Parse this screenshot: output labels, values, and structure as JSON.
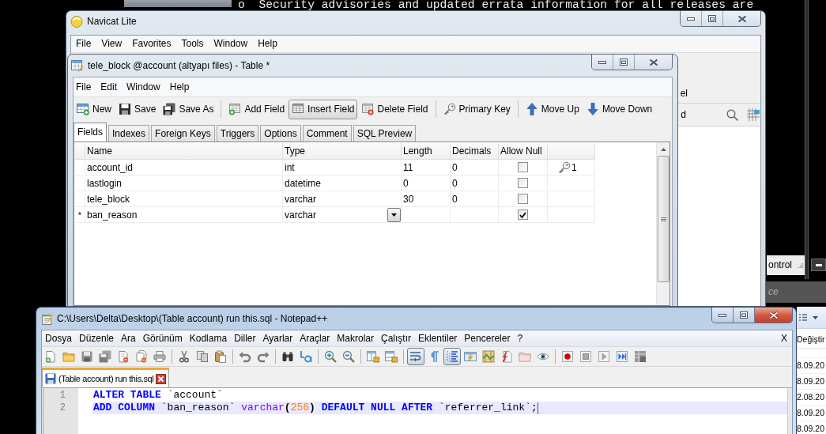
{
  "background_terminal": {
    "lines": [
      "o  Security advisories and updated errata information for all releases are"
    ]
  },
  "navicat_window": {
    "title": "Navicat Lite",
    "active": false,
    "menu": [
      "File",
      "View",
      "Favorites",
      "Tools",
      "Window",
      "Help"
    ],
    "toolbar_fragment": "el",
    "tab_fragment": "d"
  },
  "table_window": {
    "title": "tele_block @account (altyapı files) - Table *",
    "active": false,
    "menu": [
      "File",
      "Edit",
      "Window",
      "Help"
    ],
    "toolbar": [
      [
        {
          "label": "New",
          "pressed": false
        },
        {
          "label": "Save",
          "pressed": false
        },
        {
          "label": "Save As",
          "pressed": false
        }
      ],
      [
        {
          "label": "Add Field",
          "pressed": false
        },
        {
          "label": "Insert Field",
          "pressed": true
        },
        {
          "label": "Delete Field",
          "pressed": false
        }
      ],
      [
        {
          "label": "Primary Key",
          "pressed": false
        }
      ],
      [
        {
          "label": "Move Up",
          "pressed": false
        },
        {
          "label": "Move Down",
          "pressed": false
        }
      ]
    ],
    "tabs": [
      {
        "label": "Fields",
        "selected": true
      },
      {
        "label": "Indexes",
        "selected": false
      },
      {
        "label": "Foreign Keys",
        "selected": false
      },
      {
        "label": "Triggers",
        "selected": false
      },
      {
        "label": "Options",
        "selected": false
      },
      {
        "label": "Comment",
        "selected": false
      },
      {
        "label": "SQL Preview",
        "selected": false
      }
    ],
    "grid": {
      "columns": [
        "Name",
        "Type",
        "Length",
        "Decimals",
        "Allow Null"
      ],
      "rows": [
        {
          "name": "account_id",
          "type": "int",
          "length": "11",
          "decimals": "0",
          "allow_null": false,
          "editing": false,
          "key": "1"
        },
        {
          "name": "lastlogin",
          "type": "datetime",
          "length": "0",
          "decimals": "0",
          "allow_null": false,
          "editing": false
        },
        {
          "name": "tele_block",
          "type": "varchar",
          "length": "30",
          "decimals": "0",
          "allow_null": false,
          "editing": false
        },
        {
          "marker": "*",
          "name": "ban_reason",
          "type": "varchar",
          "allow_null": true,
          "editing": true
        }
      ]
    }
  },
  "console_window": {
    "status_text": "ontrol"
  },
  "search_field": {
    "placeholder": "ce"
  },
  "explorer_window": {
    "column_header": "Değiştir",
    "rows": [
      "8.09.20",
      "8.09.20",
      "2.08.20",
      "8.09.20",
      "8.09.20"
    ]
  },
  "notepad_window": {
    "title": "C:\\Users\\Delta\\Desktop\\(Table account) run this.sql - Notepad++",
    "active": true,
    "menu": [
      "Dosya",
      "Düzenle",
      "Ara",
      "Görünüm",
      "Kodlama",
      "Diller",
      "Ayarlar",
      "Araçlar",
      "Makrolar",
      "Çalıştır",
      "Eklentiler",
      "Pencereler",
      "?"
    ],
    "close_document": "X",
    "toolbar": [
      [
        {
          "pressed": false
        },
        {
          "pressed": false
        },
        {
          "pressed": false
        },
        {
          "pressed": false
        },
        {
          "pressed": false
        },
        {
          "pressed": false
        },
        {
          "pressed": false
        }
      ],
      [
        {
          "pressed": false
        },
        {
          "pressed": false
        },
        {
          "pressed": false
        }
      ],
      [
        {
          "pressed": false
        },
        {
          "pressed": false
        }
      ],
      [
        {
          "pressed": false
        },
        {
          "pressed": false
        }
      ],
      [
        {
          "pressed": false
        },
        {
          "pressed": false
        }
      ],
      [
        {
          "pressed": false
        },
        {
          "pressed": false
        }
      ],
      [
        {
          "pressed": true
        },
        {
          "pressed": false
        },
        {
          "pressed": true
        },
        {
          "pressed": false
        },
        {
          "pressed": false
        },
        {
          "pressed": false
        },
        {
          "pressed": false
        },
        {
          "pressed": false
        }
      ],
      [
        {
          "pressed": false
        },
        {
          "pressed": false
        },
        {
          "pressed": false
        },
        {
          "pressed": false
        },
        {
          "pressed": false
        }
      ]
    ],
    "tabs": [
      {
        "label": "(Table account) run this.sql",
        "selected": true
      }
    ],
    "lines": [
      {
        "number": "1",
        "current": false,
        "tokens": [
          {
            "kind": "keyword",
            "text": "ALTER TABLE"
          },
          {
            "kind": "plain",
            "text": " `account`"
          }
        ]
      },
      {
        "number": "2",
        "current": true,
        "tokens": [
          {
            "kind": "keyword",
            "text": "ADD COLUMN"
          },
          {
            "kind": "plain",
            "text": " `ban_reason` "
          },
          {
            "kind": "type",
            "text": "varchar"
          },
          {
            "kind": "operator",
            "text": "("
          },
          {
            "kind": "number",
            "text": "256"
          },
          {
            "kind": "operator",
            "text": ") "
          },
          {
            "kind": "keyword",
            "text": "DEFAULT NULL AFTER"
          },
          {
            "kind": "plain",
            "text": " `referrer_link`;"
          }
        ]
      }
    ]
  }
}
